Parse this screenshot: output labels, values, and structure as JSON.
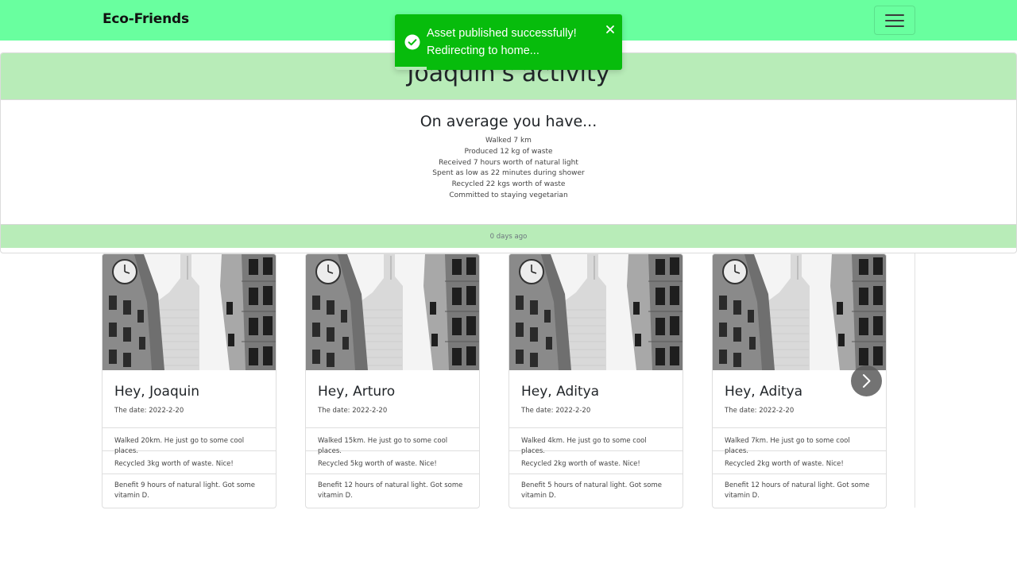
{
  "navbar": {
    "brand": "Eco-Friends",
    "menu_icon": "hamburger-menu-icon"
  },
  "toast": {
    "line1": "Asset published successfully!",
    "line2": "Redirecting to home...",
    "status_icon": "check-circle-icon",
    "close_icon": "close-icon",
    "progress": 0.14,
    "color": "#07bc0c"
  },
  "activity": {
    "title": "Joaquin's activity",
    "avg_title": "On average you have...",
    "stats": [
      "Walked 7 km",
      "Produced 12 kg of waste",
      "Received 7 hours worth of natural light",
      "Spent as low as 22 minutes during shower",
      "Recycled 22 kgs worth of waste",
      "Committed to staying vegetarian"
    ],
    "footer": "0 days ago",
    "header_color": "#b8ecb8"
  },
  "cards": [
    {
      "name": "Hey, Joaquin",
      "date": "The date: 2022-2-20",
      "walked": "Walked 20km. He just go to some cool places.",
      "recycled": "Recycled 3kg worth of waste. Nice!",
      "light": "Benefit 9 hours of natural light. Got some vitamin D."
    },
    {
      "name": "Hey, Arturo",
      "date": "The date: 2022-2-20",
      "walked": "Walked 15km. He just go to some cool places.",
      "recycled": "Recycled 5kg worth of waste. Nice!",
      "light": "Benefit 12 hours of natural light. Got some vitamin D."
    },
    {
      "name": "Hey, Aditya",
      "date": "The date: 2022-2-20",
      "walked": "Walked 4km. He just go to some cool places.",
      "recycled": "Recycled 2kg worth of waste. Nice!",
      "light": "Benefit 5 hours of natural light. Got some vitamin D."
    },
    {
      "name": "Hey, Aditya",
      "date": "The date: 2022-2-20",
      "walked": "Walked 7km. He just go to some cool places.",
      "recycled": "Recycled 2kg worth of waste. Nice!",
      "light": "Benefit 12 hours of natural light. Got some vitamin D."
    }
  ],
  "carousel": {
    "next_icon": "chevron-right-icon"
  },
  "colors": {
    "navbar": "#69ff9f",
    "toast": "#07bc0c"
  }
}
